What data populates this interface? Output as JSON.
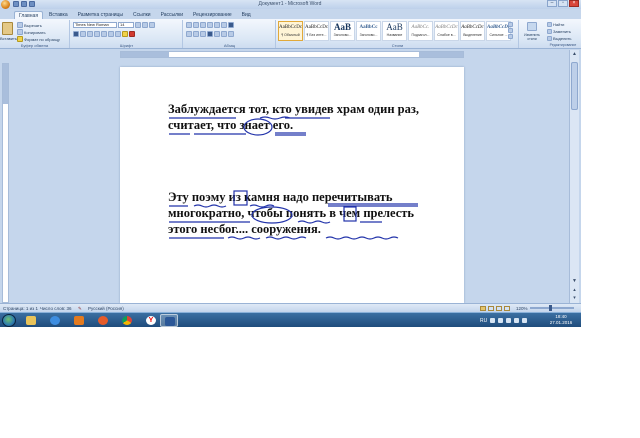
{
  "window": {
    "title": "Документ1 - Microsoft Word"
  },
  "tabs": [
    "Главная",
    "Вставка",
    "Разметка страницы",
    "Ссылки",
    "Рассылки",
    "Рецензирование",
    "Вид"
  ],
  "ribbon": {
    "clipboard": {
      "paste": "Вставить",
      "cut": "Вырезать",
      "copy": "Копировать",
      "format_painter": "Формат по образцу",
      "group_label": "Буфер обмена"
    },
    "font": {
      "font_name": "Times New Roman",
      "font_size": "14",
      "group_label": "Шрифт"
    },
    "paragraph": {
      "group_label": "Абзац"
    },
    "styles": {
      "items": [
        {
          "sample": "AaBbCcDc",
          "name": "¶ Обычный"
        },
        {
          "sample": "AaBbCcDc",
          "name": "¶ Без инте..."
        },
        {
          "sample": "AaB",
          "name": "Заголово..."
        },
        {
          "sample": "AaBbCc",
          "name": "Заголово..."
        },
        {
          "sample": "AaB",
          "name": "Название"
        },
        {
          "sample": "AaBbCc.",
          "name": "Подзагол..."
        },
        {
          "sample": "AaBbCcDc",
          "name": "Слабое в..."
        },
        {
          "sample": "AaBbCcDc",
          "name": "Выделение"
        },
        {
          "sample": "AaBbCcDc",
          "name": "Сильное ..."
        }
      ],
      "change_styles": "Изменить стили",
      "group_label": "Стили"
    },
    "editing": {
      "find": "Найти",
      "replace": "Заменить",
      "select": "Выделить",
      "group_label": "Редактирование"
    }
  },
  "document": {
    "paragraph1": "Заблуждается тот, кто увидев храм один раз, считает, что знает его.",
    "paragraph2": "Эту поэму из камня надо перечитывать многократно, чтобы понять в чем прелесть этого несбог.... сооружения."
  },
  "statusbar": {
    "page": "Страница: 1 из 1",
    "words": "Число слов: 36",
    "language": "Русский (Россия)",
    "zoom": "120%"
  },
  "taskbar": {
    "lang": "RU",
    "time": "18:40",
    "date": "27.01.2016"
  },
  "colors": {
    "ribbon": "#dbe7f5",
    "taskbar": "#1f4c7c",
    "ink": "#2233aa"
  }
}
